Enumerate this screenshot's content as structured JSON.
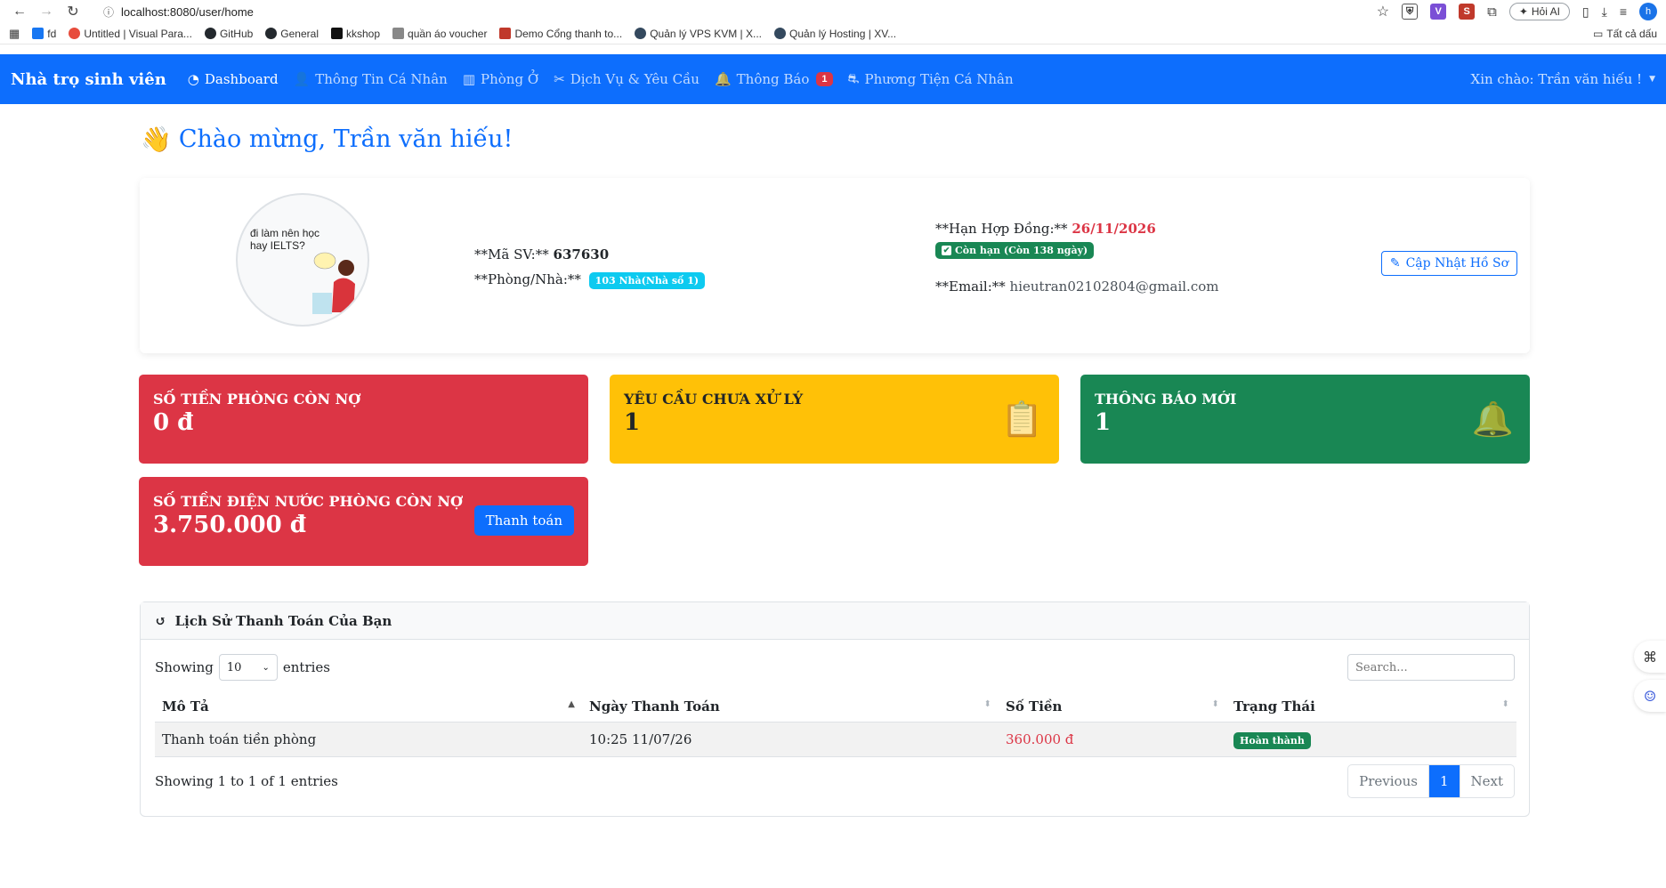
{
  "browser": {
    "url": "localhost:8080/user/home",
    "ask_ai": "Hỏi AI",
    "profile_letter": "h",
    "bookmarks": [
      {
        "label": "fd",
        "color": "#1877f2"
      },
      {
        "label": "Untitled | Visual Para...",
        "color": "#e74c3c"
      },
      {
        "label": "GitHub",
        "color": "#24292e"
      },
      {
        "label": "General",
        "color": "#24292e"
      },
      {
        "label": "kkshop",
        "color": "#111111"
      },
      {
        "label": "quần áo voucher",
        "color": "#555555"
      },
      {
        "label": "Demo Cổng thanh to...",
        "color": "#c0392b"
      },
      {
        "label": "Quản lý VPS KVM | X...",
        "color": "#34495e"
      },
      {
        "label": "Quản lý Hosting | XV...",
        "color": "#34495e"
      }
    ],
    "all_bookmarks": "Tất cả dấu"
  },
  "navbar": {
    "brand": "Nhà trọ sinh viên",
    "items": [
      {
        "label": "Dashboard",
        "icon": "dashboard-icon",
        "glyph": "◔"
      },
      {
        "label": "Thông Tin Cá Nhân",
        "icon": "user-icon",
        "glyph": "👤"
      },
      {
        "label": "Phòng Ở",
        "icon": "building-icon",
        "glyph": "▥"
      },
      {
        "label": "Dịch Vụ & Yêu Cầu",
        "icon": "tools-icon",
        "glyph": "✂"
      },
      {
        "label": "Thông Báo",
        "icon": "bell-icon",
        "glyph": "🔔",
        "badge": "1"
      },
      {
        "label": "Phương Tiện Cá Nhân",
        "icon": "motorcycle-icon",
        "glyph": "⛐"
      }
    ],
    "user": "Xin chào: Trần văn hiếu !"
  },
  "welcome": {
    "emoji": "👋",
    "text": "Chào mừng, Trần văn hiếu!"
  },
  "profile": {
    "avatar_caption": "đi làm nên học hay IELTS?",
    "student_id_label": "**Mã SV:**",
    "student_id": "637630",
    "room_label": "**Phòng/Nhà:**",
    "room": "103 Nhà(Nhà số 1)",
    "contract_label": "**Hạn Hợp Đồng:**",
    "contract_date": "26/11/2026",
    "contract_status": "Còn hạn (Còn 138 ngày)",
    "email_label": "**Email:**",
    "email": "hieutran02102804@gmail.com",
    "update_button": "Cập Nhật Hồ Sơ"
  },
  "stats": {
    "room_debt": {
      "title": "Số tiền phòng còn nợ",
      "value": "0 đ"
    },
    "pending_requests": {
      "title": "Yêu cầu chưa xử lý",
      "value": "1"
    },
    "new_notifications": {
      "title": "Thông báo mới",
      "value": "1"
    },
    "utility_debt": {
      "title": "Số tiền điện nước phòng còn nợ",
      "value": "3.750.000 đ",
      "button": "Thanh toán"
    }
  },
  "history": {
    "title": "Lịch Sử Thanh Toán Của Bạn",
    "showing_label": "Showing",
    "page_length": "10",
    "entries_label": "entries",
    "search_placeholder": "Search...",
    "columns": [
      "Mô Tả",
      "Ngày Thanh Toán",
      "Số Tiền",
      "Trạng Thái"
    ],
    "rows": [
      {
        "description": "Thanh toán tiền phòng",
        "date": "10:25 11/07/26",
        "amount": "360.000 đ",
        "status": "Hoàn thành"
      }
    ],
    "info": "Showing 1 to 1 of 1 entries",
    "pagination": {
      "previous": "Previous",
      "current": "1",
      "next": "Next"
    }
  }
}
